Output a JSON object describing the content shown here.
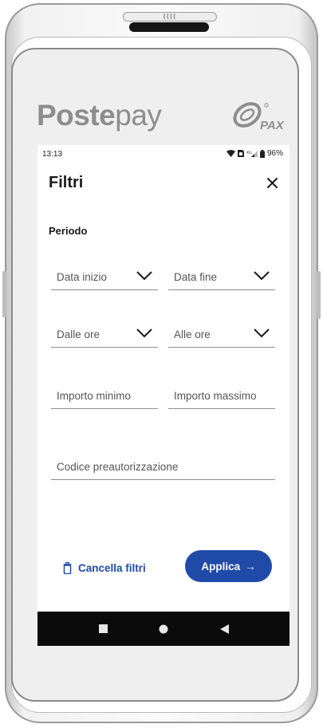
{
  "device": {
    "nfc_mark": "(((("
  },
  "brand": {
    "bold": "Poste",
    "light": "pay",
    "partner_logo": "PAX"
  },
  "status_bar": {
    "time": "13:13",
    "battery": "96%",
    "icons": [
      "wifi-icon",
      "sim-icon",
      "signal-icon",
      "battery-icon"
    ]
  },
  "header": {
    "title": "Filtri",
    "close_icon": "close-icon"
  },
  "period": {
    "label": "Periodo"
  },
  "fields": {
    "start_date": "Data inizio",
    "end_date": "Data fine",
    "from_time": "Dalle ore",
    "to_time": "Alle ore",
    "min_amount": "Importo minimo",
    "max_amount": "Importo massimo",
    "preauth_code": "Codice preautorizzazione"
  },
  "actions": {
    "clear_filters": "Cancella filtri",
    "apply": "Applica",
    "apply_arrow": "→"
  },
  "navbar": {
    "icons": [
      "recents-icon",
      "home-icon",
      "back-icon"
    ]
  },
  "colors": {
    "accent": "#1f4aa8",
    "brand_gray": "#8d8d8d"
  }
}
